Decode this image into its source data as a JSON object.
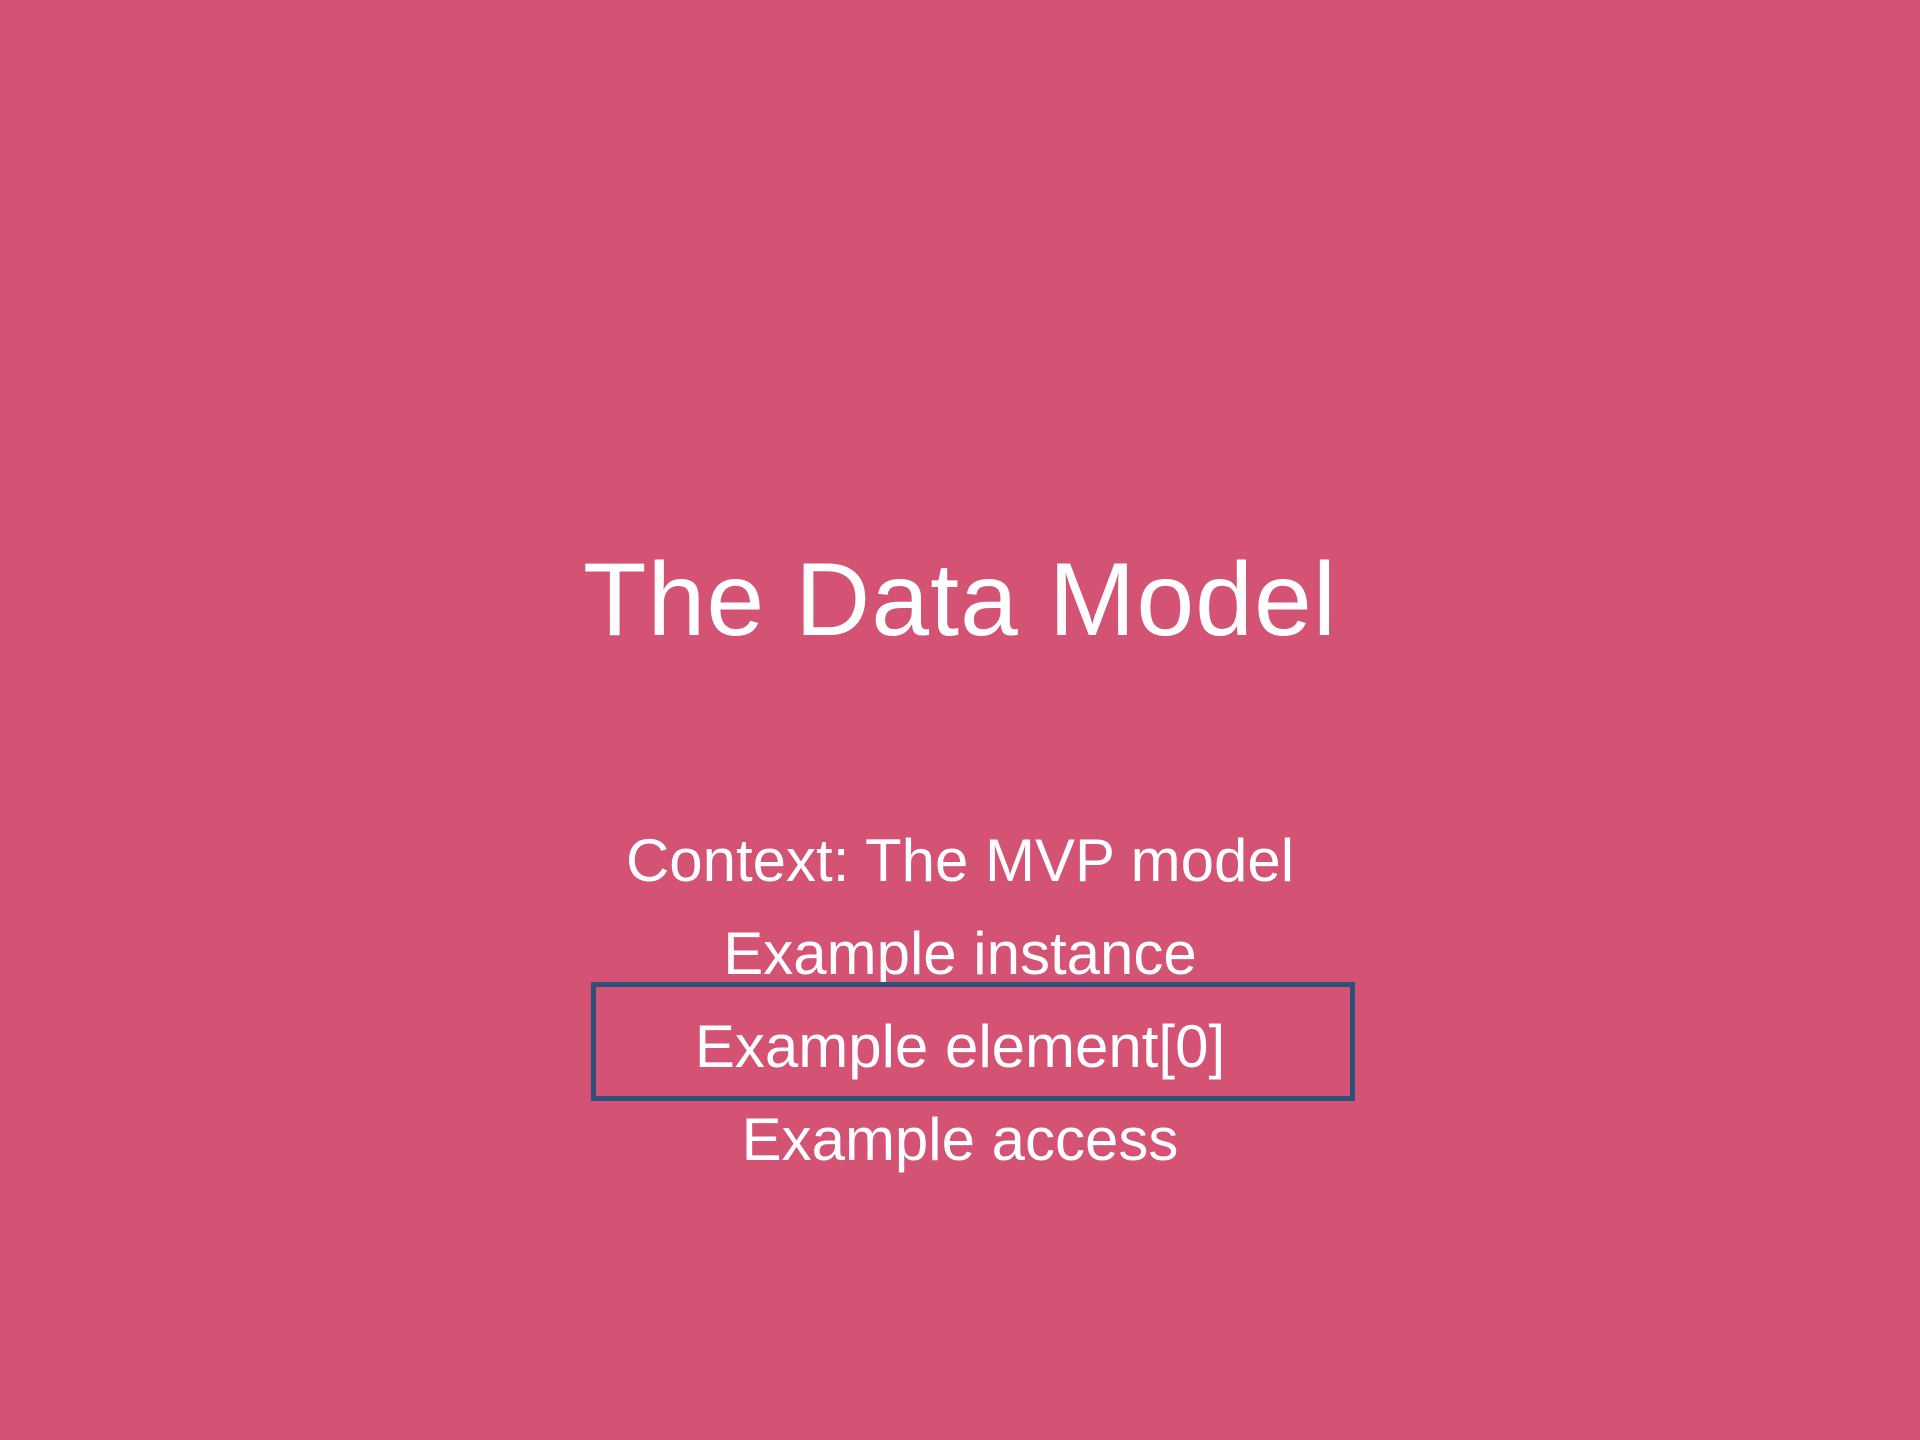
{
  "slide": {
    "title": "The Data Model",
    "agenda": [
      "Context: The MVP model",
      "Example instance",
      "Example element[0]",
      "Example access"
    ],
    "current_index": 2
  },
  "colors": {
    "background": "#d45274",
    "text": "#ffffff",
    "highlight_border": "#2e5179"
  }
}
